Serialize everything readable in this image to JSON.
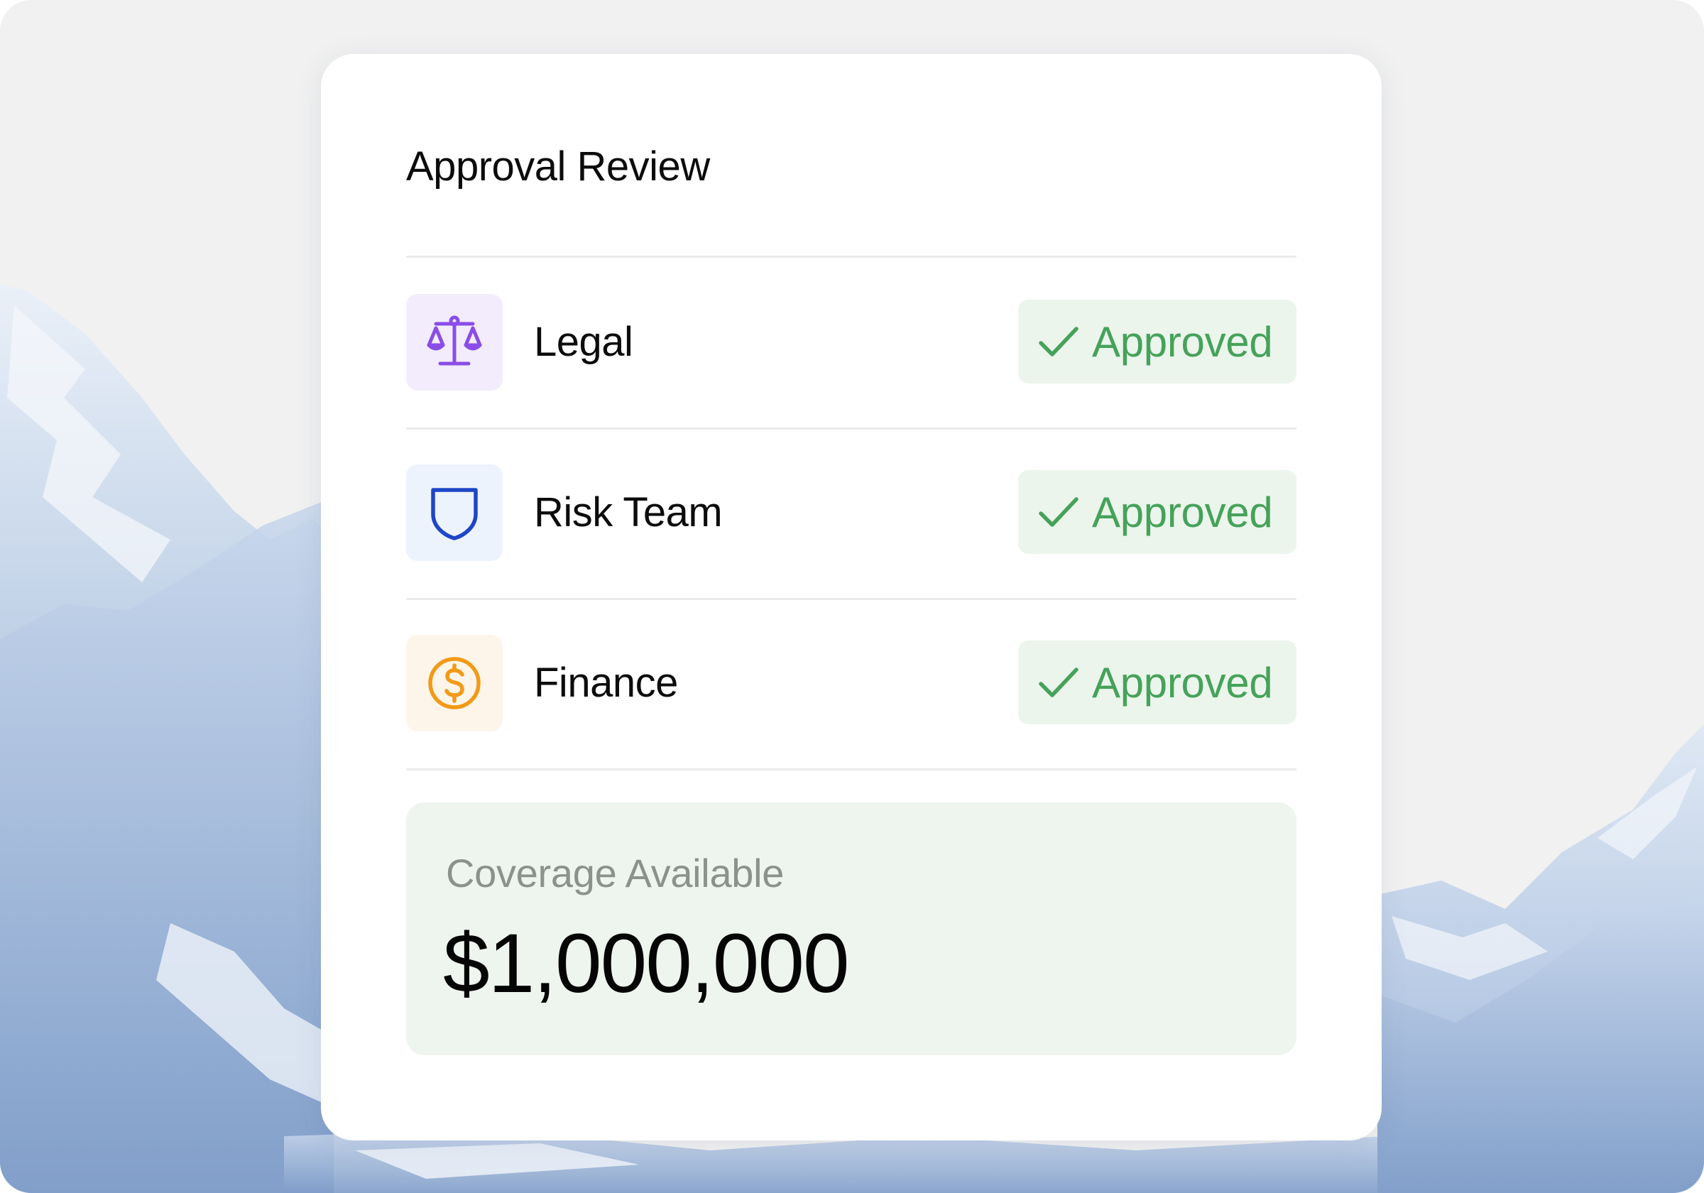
{
  "card": {
    "title": "Approval Review"
  },
  "approvals": [
    {
      "label": "Legal",
      "icon": "scales-icon",
      "status": "Approved",
      "icon_color": "#8a4de8",
      "icon_bg": "#f2ecfd"
    },
    {
      "label": "Risk Team",
      "icon": "shield-icon",
      "status": "Approved",
      "icon_color": "#1e46c8",
      "icon_bg": "#edf3fd"
    },
    {
      "label": "Finance",
      "icon": "dollar-coin-icon",
      "status": "Approved",
      "icon_color": "#f29a18",
      "icon_bg": "#fdf5ea"
    }
  ],
  "status_colors": {
    "approved_text": "#46a25a",
    "approved_bg": "#ebf5ec",
    "check_icon": "check-icon"
  },
  "coverage": {
    "label": "Coverage Available",
    "amount": "$1,000,000"
  }
}
